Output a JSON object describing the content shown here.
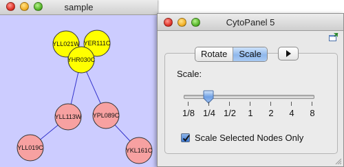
{
  "sample_window": {
    "title": "sample",
    "background": "#ccccff",
    "nodes": [
      {
        "id": "YLL021W",
        "label": "YLL021W",
        "color": "#ffff00"
      },
      {
        "id": "YER111C",
        "label": "YER111C",
        "color": "#ffff00"
      },
      {
        "id": "YHR030C",
        "label": "YHR030C",
        "color": "#ffff00"
      },
      {
        "id": "YLL113W",
        "label": "YLL113W",
        "color": "#f7a1a1"
      },
      {
        "id": "YPL089C",
        "label": "YPL089C",
        "color": "#f7a1a1"
      },
      {
        "id": "YLL019C",
        "label": "YLL019C",
        "color": "#f7a1a1"
      },
      {
        "id": "YKL161C",
        "label": "YKL161C",
        "color": "#f7a1a1"
      }
    ],
    "edges": [
      {
        "source": "YHR030C",
        "target": "YLL021W"
      },
      {
        "source": "YHR030C",
        "target": "YER111C"
      },
      {
        "source": "YHR030C",
        "target": "YLL113W"
      },
      {
        "source": "YHR030C",
        "target": "YPL089C"
      },
      {
        "source": "YLL113W",
        "target": "YLL019C"
      },
      {
        "source": "YPL089C",
        "target": "YKL161C"
      }
    ],
    "edge_color": "#3333cc"
  },
  "cytopanel": {
    "title": "CytoPanel 5",
    "tabs": [
      {
        "label": "Rotate",
        "selected": false
      },
      {
        "label": "Scale",
        "selected": true
      }
    ],
    "scale_label": "Scale:",
    "slider": {
      "ticks": [
        "1/8",
        "1/4",
        "1/2",
        "1",
        "2",
        "4",
        "8"
      ],
      "selected": "1/4"
    },
    "checkbox": {
      "label": "Scale Selected Nodes Only",
      "checked": true
    },
    "accent": "#3a78d3"
  }
}
